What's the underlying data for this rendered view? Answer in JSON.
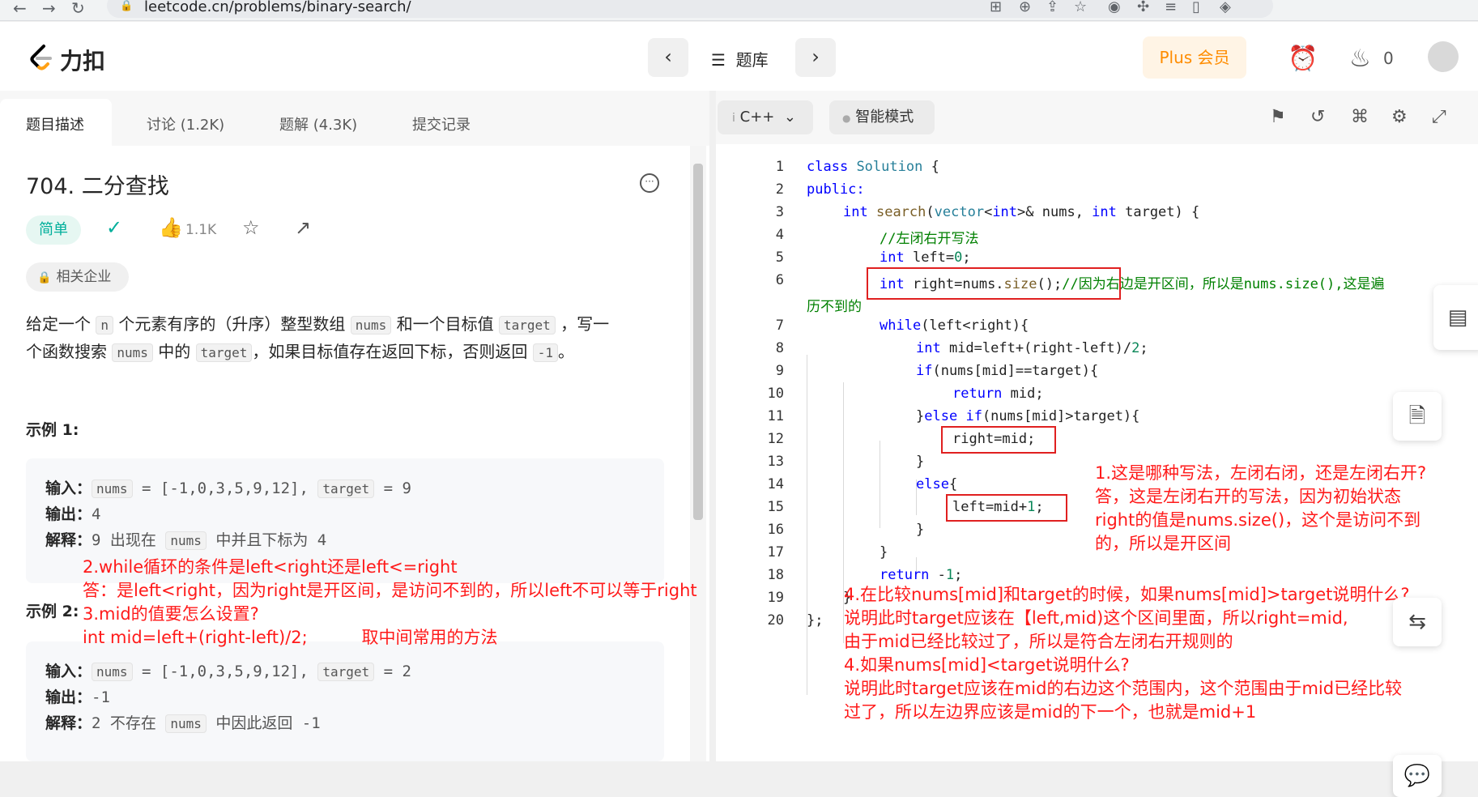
{
  "browser": {
    "url": "leetcode.cn/problems/binary-search/"
  },
  "header": {
    "logo_text": "力扣",
    "problem_list_label": "题库",
    "plus_label": "Plus 会员",
    "fire_count": "0"
  },
  "tabs": [
    {
      "label": "题目描述"
    },
    {
      "label": "讨论 (1.2K)"
    },
    {
      "label": "题解 (4.3K)"
    },
    {
      "label": "提交记录"
    }
  ],
  "problem": {
    "title": "704. 二分查找",
    "difficulty": "简单",
    "likes": "1.1K",
    "company_tag": "相关企业",
    "desc": {
      "p1": "给定一个",
      "n": "n",
      "p2": "个元素有序的（升序）整型数组",
      "nums": "nums",
      "p3": "和一个目标值",
      "target": "target",
      "p4": "，写一",
      "p5": "个函数搜索",
      "p6": "中的",
      "p7": "，如果目标值存在返回下标，否则返回",
      "neg1": "-1",
      "p8": "。"
    },
    "example1": {
      "heading": "示例 1:",
      "input_label": "输入：",
      "input_nums_val": "= [-1,0,3,5,9,12],",
      "input_target_val": "= 9",
      "output_label": "输出：",
      "output_val": "4",
      "explain_label": "解释：",
      "explain_pre": "9 出现在",
      "explain_post": "中并且下标为 4"
    },
    "example2": {
      "heading": "示例 2:",
      "input_label": "输入：",
      "input_nums_val": "= [-1,0,3,5,9,12],",
      "input_target_val": "= 2",
      "output_label": "输出：",
      "output_val": "-1",
      "explain_label": "解释：",
      "explain_pre": "2 不存在",
      "explain_post": "中因此返回 -1"
    }
  },
  "editor": {
    "language": "C++",
    "mode": "智能模式",
    "line_numbers": [
      "1",
      "2",
      "3",
      "4",
      "5",
      "6",
      "7",
      "8",
      "9",
      "10",
      "11",
      "12",
      "13",
      "14",
      "15",
      "16",
      "17",
      "18",
      "19",
      "20"
    ],
    "code": {
      "l1a": "class",
      "l1b": "Solution",
      "l1c": " {",
      "l2": "public:",
      "l3a": "int",
      "l3b": "search",
      "l3c": "(",
      "l3d": "vector",
      "l3e": "<",
      "l3f": "int",
      "l3g": ">& nums, ",
      "l3h": "int",
      "l3i": " target) {",
      "l4": "//左闭右开写法",
      "l5a": "int",
      "l5b": " left=",
      "l5c": "0",
      "l5d": ";",
      "l6a": "int",
      "l6b": " right=nums.",
      "l6c": "size",
      "l6d": "();",
      "l6e": "//因为右边是开区间，所以是nums.size(),这是遍",
      "l6f": "历不到的",
      "l7a": "while",
      "l7b": "(left<right){",
      "l8a": "int",
      "l8b": " mid=left+(right-left)/",
      "l8c": "2",
      "l8d": ";",
      "l9a": "if",
      "l9b": "(nums[mid]==target){",
      "l10a": "return",
      "l10b": " mid;",
      "l11a": "}",
      "l11b": "else",
      "l11c": " ",
      "l11d": "if",
      "l11e": "(nums[mid]>target){",
      "l12": "right=mid;",
      "l13": "}",
      "l14a": "else",
      "l14b": "{",
      "l15a": "left=mid+",
      "l15b": "1",
      "l15c": ";",
      "l16": "}",
      "l17": "}",
      "l18a": "return",
      "l18b": " -",
      "l18c": "1",
      "l18d": ";",
      "l19": "}",
      "l20": "};"
    }
  },
  "annotations": {
    "note1": [
      "1.这是哪种写法，左闭右闭，还是左闭右开?",
      "答，这是左闭右开的写法，因为初始状态",
      "right的值是nums.size()，这个是访问不到",
      "的，所以是开区间"
    ],
    "note2": [
      "2.while循环的条件是left<right还是left<=right",
      "答：是left<right，因为right是开区间，是访问不到的，所以left不可以等于right",
      "3.mid的值要怎么设置?"
    ],
    "note2_code": "int mid=left+(right-left)/2;",
    "note2_comment": "取中间常用的方法",
    "note4": [
      "4.在比较nums[mid]和target的时候，如果nums[mid]>target说明什么?",
      "说明此时target应该在【left,mid)这个区间里面，所以right=mid,",
      "由于mid已经比较过了，所以是符合左闭右开规则的",
      "4.如果nums[mid]<target说明什么?",
      "说明此时target应该在mid的右边这个范围内，这个范围由于mid已经比较",
      "过了，所以左边界应该是mid的下一个，也就是mid+1"
    ]
  },
  "colors": {
    "annotation_red": "#ff1a1a",
    "difficulty_green": "#00af9b",
    "plus_orange": "#ff8c00"
  }
}
